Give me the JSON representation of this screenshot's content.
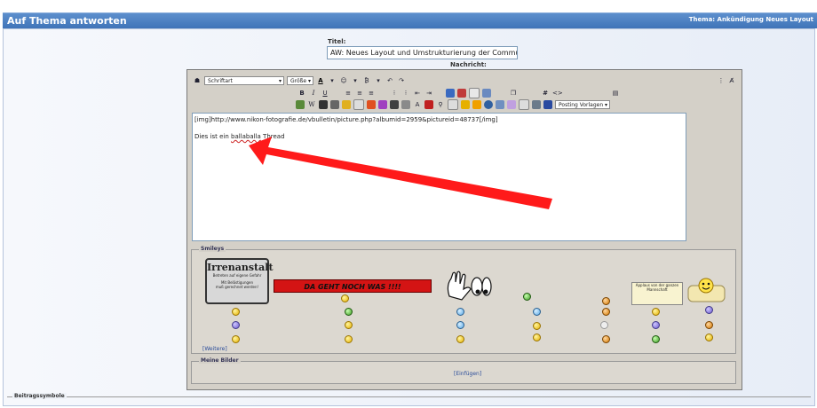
{
  "header": {
    "title": "Auf Thema antworten",
    "thread": "Thema: Ankündigung Neues Layout"
  },
  "form": {
    "title_label": "Titel:",
    "title_value": "AW: Neues Layout und Umstrukturierung der Community",
    "message_label": "Nachricht:"
  },
  "toolbar": {
    "font_label": "Schriftart",
    "size_label": "Größe",
    "bold": "B",
    "italic": "I",
    "underline": "U",
    "font_color": "A",
    "hash": "#",
    "code": "<>",
    "undo": "↶",
    "redo": "↷",
    "posting_templates": "Posting Vorlagen"
  },
  "message": {
    "line1": "[img]http://www.nikon-fotografie.de/vbulletin/picture.php?albumid=2959&pictureid=48737[/img]",
    "line2_prefix": "Dies ist ein ",
    "line2_misspelled": "ballaballa",
    "line2_suffix": " Thread"
  },
  "smilies": {
    "legend": "Smileys",
    "irren_title": "Irrenanstalt",
    "irren_line1": "Betreten auf eigene Gefahr",
    "irren_line2": "Mit Belästigungen",
    "irren_line3": "muß gerechnet werden!",
    "banner": "DA GEHT NOCH WAS !!!!",
    "applause": "Applaus von der ganzen Mannschaft",
    "more": "[Weitere]"
  },
  "images": {
    "legend": "Meine Bilder",
    "insert": "[Einfügen]"
  },
  "post_icons": {
    "legend": "Beitragssymbole"
  },
  "colors": {
    "header_bg": "#3f74b8",
    "annotation_arrow": "#ff1a1a"
  }
}
